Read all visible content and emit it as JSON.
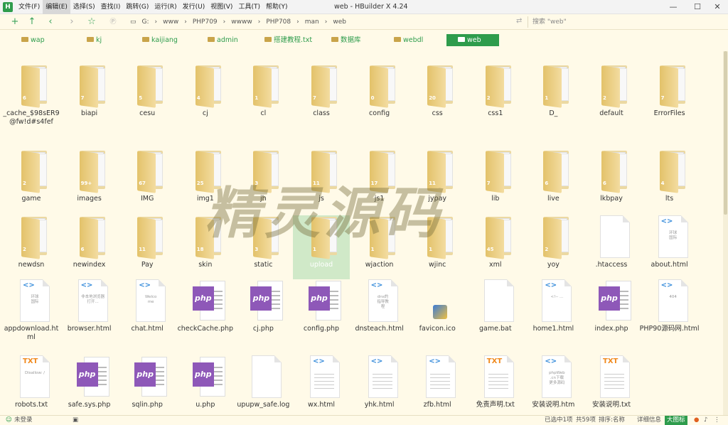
{
  "app": {
    "icon": "H",
    "title": "web - HBuilder X 4.24"
  },
  "menu": [
    "文件(F)",
    "编辑(E)",
    "选择(S)",
    "查找(I)",
    "跳转(G)",
    "运行(R)",
    "发行(U)",
    "视图(V)",
    "工具(T)",
    "帮助(Y)"
  ],
  "window_controls": {
    "minimize": "—",
    "maximize": "☐",
    "close": "✕"
  },
  "toolbar": {
    "icons": [
      "plus-icon",
      "arrow-up-icon",
      "arrow-left-icon",
      "arrow-right-icon",
      "star-icon",
      "preview-icon"
    ],
    "address": [
      "G:",
      "www",
      "PHP709",
      "wwww",
      "PHP708",
      "man",
      "web"
    ],
    "search_placeholder": "搜索 \"web\""
  },
  "favorites": [
    {
      "label": "wap"
    },
    {
      "label": "kj"
    },
    {
      "label": "kaijiang"
    },
    {
      "label": "admin"
    },
    {
      "label": "搭建教程.txt"
    },
    {
      "label": "数据库"
    },
    {
      "label": "webdl"
    },
    {
      "label": "web",
      "selected": true
    }
  ],
  "rows": [
    [
      {
        "name": "_cache_$98sER9@fw!d#s4fef",
        "type": "folder",
        "count": "6"
      },
      {
        "name": "biapi",
        "type": "folder",
        "count": "7"
      },
      {
        "name": "cesu",
        "type": "folder",
        "count": "5"
      },
      {
        "name": "cj",
        "type": "folder",
        "count": "4"
      },
      {
        "name": "cl",
        "type": "folder",
        "count": "1"
      },
      {
        "name": "class",
        "type": "folder",
        "count": "7"
      },
      {
        "name": "config",
        "type": "folder",
        "count": "0"
      },
      {
        "name": "css",
        "type": "folder",
        "count": "20"
      },
      {
        "name": "css1",
        "type": "folder",
        "count": "2"
      },
      {
        "name": "D_",
        "type": "folder",
        "count": "1"
      },
      {
        "name": "default",
        "type": "folder",
        "count": "2"
      },
      {
        "name": "ErrorFiles",
        "type": "folder",
        "count": "7"
      }
    ],
    [
      {
        "name": "game",
        "type": "folder",
        "count": "2"
      },
      {
        "name": "images",
        "type": "folder",
        "count": "99+"
      },
      {
        "name": "IMG",
        "type": "folder",
        "count": "67"
      },
      {
        "name": "img1",
        "type": "folder",
        "count": "25"
      },
      {
        "name": "jh",
        "type": "folder",
        "count": "3"
      },
      {
        "name": "js",
        "type": "folder",
        "count": "11"
      },
      {
        "name": "js1",
        "type": "folder",
        "count": "17"
      },
      {
        "name": "jypay",
        "type": "folder",
        "count": "11"
      },
      {
        "name": "lib",
        "type": "folder",
        "count": "7"
      },
      {
        "name": "live",
        "type": "folder",
        "count": "6"
      },
      {
        "name": "lkbpay",
        "type": "folder",
        "count": "6"
      },
      {
        "name": "lts",
        "type": "folder",
        "count": "4"
      }
    ],
    [
      {
        "name": "newdsn",
        "type": "folder",
        "count": "2"
      },
      {
        "name": "newindex",
        "type": "folder",
        "count": "6"
      },
      {
        "name": "Pay",
        "type": "folder",
        "count": "11"
      },
      {
        "name": "skin",
        "type": "folder",
        "count": "18"
      },
      {
        "name": "static",
        "type": "folder",
        "count": "3"
      },
      {
        "name": "upload",
        "type": "folder",
        "count": "1",
        "highlight": true
      },
      {
        "name": "wjaction",
        "type": "folder",
        "count": "1"
      },
      {
        "name": "wjinc",
        "type": "folder",
        "count": "1"
      },
      {
        "name": "xml",
        "type": "folder",
        "count": "45"
      },
      {
        "name": "yoy",
        "type": "folder",
        "count": "2"
      },
      {
        "name": ".htaccess",
        "type": "blank"
      },
      {
        "name": "about.html",
        "type": "html",
        "preview": "环球\n国际"
      }
    ],
    [
      {
        "name": "appdownload.html",
        "type": "html",
        "preview": "环球\n国际"
      },
      {
        "name": "browser.html",
        "type": "html",
        "preview": "非本地浏览器打开..."
      },
      {
        "name": "chat.html",
        "type": "html",
        "preview": "Welco\nme"
      },
      {
        "name": "checkCache.php",
        "type": "php"
      },
      {
        "name": "cj.php",
        "type": "php"
      },
      {
        "name": "config.php",
        "type": "php"
      },
      {
        "name": "dnsteach.html",
        "type": "html",
        "preview": "dns的\n指导教\n程"
      },
      {
        "name": "favicon.ico",
        "type": "ico"
      },
      {
        "name": "game.bat",
        "type": "blank"
      },
      {
        "name": "home1.html",
        "type": "html",
        "preview": "<!-- ..."
      },
      {
        "name": "index.php",
        "type": "php"
      },
      {
        "name": "PHP90源码网.html",
        "type": "html",
        "preview": "404"
      }
    ],
    [
      {
        "name": "robots.txt",
        "type": "txt",
        "preview": "Disallow: /"
      },
      {
        "name": "safe.sys.php",
        "type": "php"
      },
      {
        "name": "sqlin.php",
        "type": "php"
      },
      {
        "name": "u.php",
        "type": "php"
      },
      {
        "name": "upupw_safe.log",
        "type": "blank"
      },
      {
        "name": "wx.html",
        "type": "html",
        "preview": ""
      },
      {
        "name": "yhk.html",
        "type": "html",
        "preview": ""
      },
      {
        "name": "zfb.html",
        "type": "html",
        "preview": ""
      },
      {
        "name": "免责声明.txt",
        "type": "txt",
        "preview": ""
      },
      {
        "name": "安装说明.htm",
        "type": "html",
        "preview": "phpWeb\n.cn下载\n更多源码"
      },
      {
        "name": "安装说明.txt",
        "type": "txt",
        "preview": ""
      }
    ]
  ],
  "watermark": "精灵源码",
  "statusbar": {
    "login": "未登录",
    "selected": "已选中1项",
    "total": "共59项",
    "sort": "排序:名称",
    "detail": "详细信息",
    "big": "大图标"
  },
  "colors": {
    "accent": "#2e9c4c",
    "background": "#fffae8",
    "folder": "#e3c26a",
    "php": "#8e58b8"
  }
}
